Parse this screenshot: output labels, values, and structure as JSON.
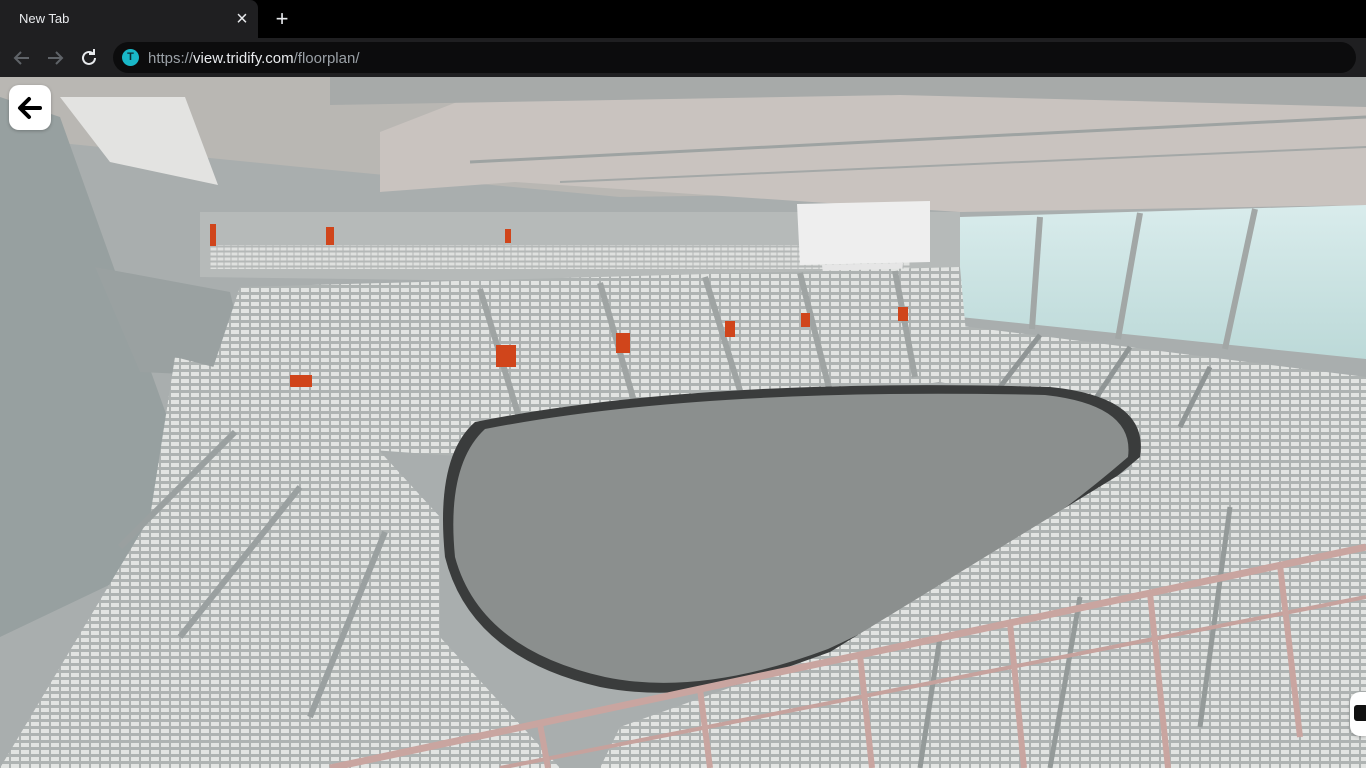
{
  "browser": {
    "tab": {
      "title": "New Tab",
      "close_icon": "close-icon"
    },
    "new_tab_icon": "plus-icon",
    "toolbar": {
      "back_icon": "arrow-left-icon",
      "forward_icon": "arrow-right-icon",
      "reload_icon": "reload-icon",
      "site_badge": "T",
      "url_scheme": "https://",
      "url_host": "view.tridify.com",
      "url_path": "/floorplan/"
    }
  },
  "viewer": {
    "back_icon": "arrow-left-icon",
    "edge_control_icon": "panel-toggle-icon",
    "scene": "3d-arena-seating-view"
  },
  "colors": {
    "tab_strip": "#000000",
    "toolbar": "#1f1f21",
    "seat_accent": "#d0451b",
    "arena_floor": "#8b8f8e",
    "seats": "#dcdedc",
    "railing": "#c9a5a0",
    "glass": "#cfe6e5"
  }
}
